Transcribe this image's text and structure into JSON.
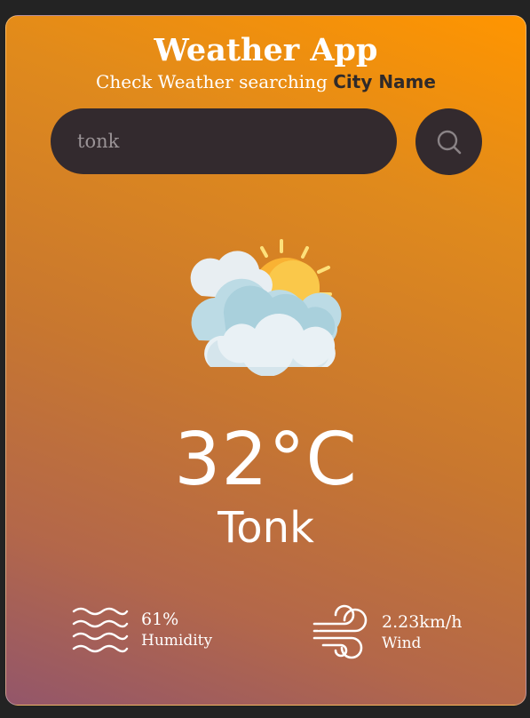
{
  "app": {
    "title": "Weather App",
    "subtitle_prefix": "Check Weather searching ",
    "subtitle_emphasis": "City Name"
  },
  "search": {
    "value": "tonk",
    "button_icon": "search-icon"
  },
  "weather": {
    "condition_icon": "partly-cloudy-sun-icon",
    "temperature": "32°C",
    "city": "Tonk"
  },
  "stats": {
    "humidity": {
      "icon": "humidity-waves-icon",
      "value": "61%",
      "label": "Humidity"
    },
    "wind": {
      "icon": "wind-icon",
      "value": "2.23km/h",
      "label": "Wind"
    }
  },
  "colors": {
    "gradient_top": "#ff9500",
    "gradient_bottom": "#93566a",
    "search_background": "#332a2e",
    "text": "#ffffff",
    "emphasis_text": "#2f2a2a"
  }
}
